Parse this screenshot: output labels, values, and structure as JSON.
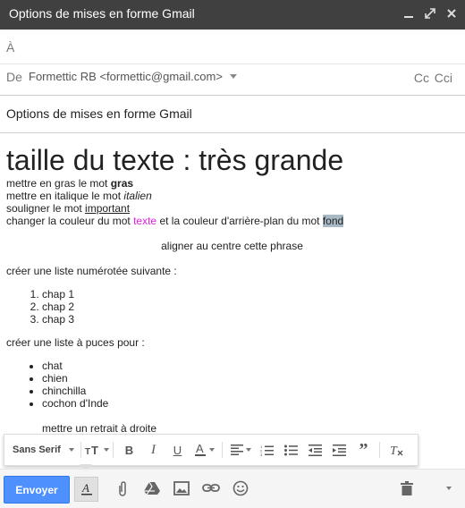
{
  "window": {
    "title": "Options de mises en forme Gmail"
  },
  "to": {
    "label": "À"
  },
  "from": {
    "label": "De",
    "value": "Formettic RB <formettic@gmail.com>",
    "cc": "Cc",
    "cci": "Cci"
  },
  "subject": {
    "value": "Options de mises en forme Gmail"
  },
  "body": {
    "heading": "taille du texte : très grande",
    "bold_prefix": "mettre en gras le mot ",
    "bold_word": "gras",
    "italic_prefix": "mettre en italique le mot ",
    "italic_word": "italien",
    "underline_prefix": "souligner le mot ",
    "underline_word": "important",
    "color_prefix": "changer la couleur du mot ",
    "color_word": "texte",
    "color_middle": " et la couleur d'arrière-plan du mot ",
    "bg_word": "fond",
    "centered": "aligner au centre cette phrase",
    "numbered_intro": "créer une liste numérotée suivante :",
    "numbered": [
      "chap 1",
      "chap 2",
      "chap 3"
    ],
    "bullet_intro": "créer une liste à puces pour :",
    "bullets": [
      "chat",
      "chien",
      "chinchilla",
      "cochon d'Inde"
    ],
    "indent_text": "mettre un retrait à droite"
  },
  "format_toolbar": {
    "font": "Sans Serif"
  },
  "bottom": {
    "send_label": "Envoyer"
  },
  "colors": {
    "send": "#4d90fe",
    "titlebar": "#404040",
    "pink": "#e021e0",
    "highlight": "#a8b8c4"
  }
}
